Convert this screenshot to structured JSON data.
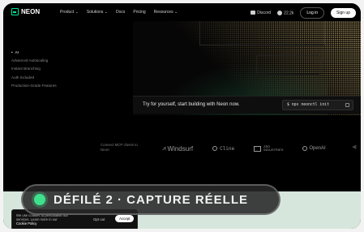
{
  "nav": {
    "logo": "NEON",
    "links": [
      "Product ⌄",
      "Solutions ⌄",
      "Docs",
      "Pricing",
      "Resources ⌄"
    ],
    "discord": "Discord",
    "github_stars": "22.2k",
    "login": "Log in",
    "signup": "Sign up"
  },
  "features": {
    "active": "AI",
    "items": [
      "Advanced Autoscaling",
      "Instant Branching",
      "Auth Included",
      "Production-Grade Features"
    ]
  },
  "cta": {
    "text": "Try for yourself, start building with Neon now.",
    "command": "$ npx neonctl init"
  },
  "partners": {
    "caption": "Connect MCP clients to Neon:",
    "windsurf": "Windsurf",
    "cline": "Cline",
    "zed_line1": "ZED",
    "zed_line2": "INDUSTRIES",
    "openai": "OpenAI"
  },
  "overlay": {
    "caption": "DÉFILÉ 2 · CAPTURE RÉELLE"
  },
  "cookie": {
    "text": "We use cookies to personalise our services. Learn more in our",
    "policy": "Cookie Policy",
    "optout": "Opt out",
    "accept": "Accept"
  },
  "colors": {
    "accent": "#00e599",
    "mint_band": "#d6e6dc",
    "pill_dot": "#3fe08c"
  }
}
